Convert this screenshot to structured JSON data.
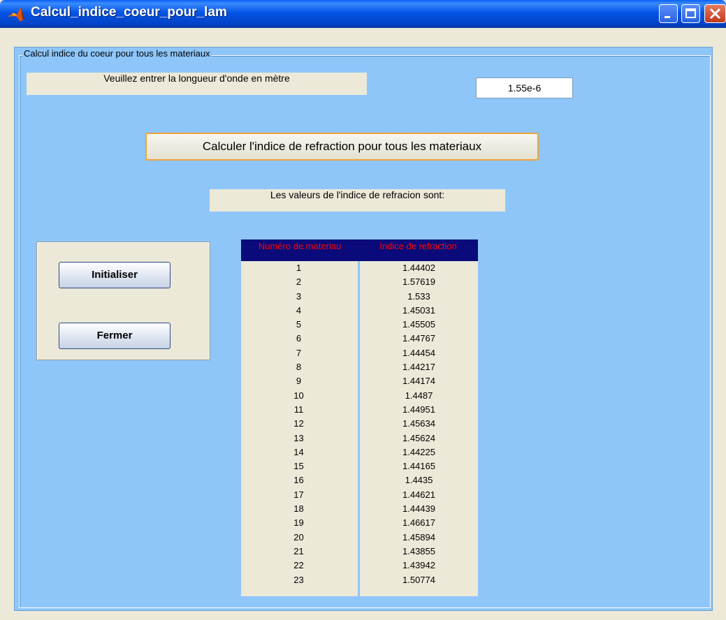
{
  "window": {
    "title": "Calcul_indice_coeur_pour_lam"
  },
  "group": {
    "label": "Calcul indice du coeur pour tous les materiaux"
  },
  "wavelength": {
    "prompt": "Veuillez entrer la longueur d'onde en mètre",
    "value": "1.55e-6"
  },
  "calc_button": {
    "label": "Calculer l'indice de refraction pour tous les materiaux"
  },
  "result_label": "Les valeurs de l'indice de refracion sont:",
  "buttons": {
    "init": "Initialiser",
    "close": "Fermer"
  },
  "table": {
    "headers": [
      "Numéro de materiau",
      "Indice de refraction"
    ],
    "rows": [
      [
        "1",
        "1.44402"
      ],
      [
        "2",
        "1.57619"
      ],
      [
        "3",
        "1.533"
      ],
      [
        "4",
        "1.45031"
      ],
      [
        "5",
        "1.45505"
      ],
      [
        "6",
        "1.44767"
      ],
      [
        "7",
        "1.44454"
      ],
      [
        "8",
        "1.44217"
      ],
      [
        "9",
        "1.44174"
      ],
      [
        "10",
        "1.4487"
      ],
      [
        "11",
        "1.44951"
      ],
      [
        "12",
        "1.45634"
      ],
      [
        "13",
        "1.45624"
      ],
      [
        "14",
        "1.44225"
      ],
      [
        "15",
        "1.44165"
      ],
      [
        "16",
        "1.4435"
      ],
      [
        "17",
        "1.44621"
      ],
      [
        "18",
        "1.44439"
      ],
      [
        "19",
        "1.46617"
      ],
      [
        "20",
        "1.45894"
      ],
      [
        "21",
        "1.43855"
      ],
      [
        "22",
        "1.43942"
      ],
      [
        "23",
        "1.50774"
      ]
    ]
  },
  "colors": {
    "background": "#8ec6f9",
    "header_bg": "#0a0a7a",
    "header_text": "#ff0000",
    "button_focus_border": "#f0a23a"
  },
  "icons": {
    "app": "matlab-logo-icon",
    "minimize": "minimize-icon",
    "maximize": "maximize-icon",
    "close": "close-icon"
  }
}
